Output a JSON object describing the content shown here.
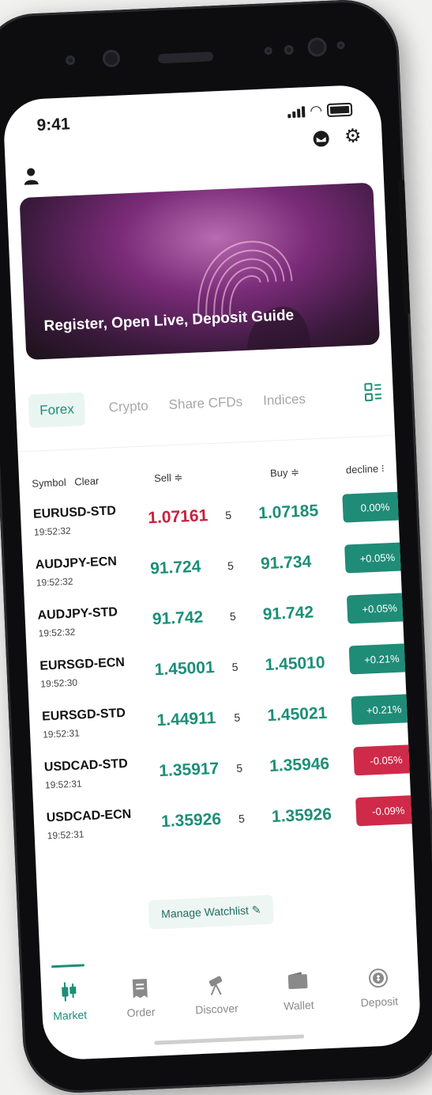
{
  "status": {
    "time": "9:41"
  },
  "header": {
    "profile_icon": "user-icon",
    "mail_icon": "mail-icon",
    "settings_icon": "gear-icon"
  },
  "banner": {
    "title": "Register, Open Live, Deposit Guide"
  },
  "tabs": [
    {
      "label": "Forex",
      "active": true
    },
    {
      "label": "Crypto"
    },
    {
      "label": "Share CFDs"
    },
    {
      "label": "Indices"
    }
  ],
  "table": {
    "headers": {
      "symbol": "Symbol",
      "clear": "Clear",
      "sell": "Sell ≑",
      "buy": "Buy ≑",
      "decline": "decline ⁝"
    },
    "rows": [
      {
        "symbol": "EURUSD-STD",
        "time": "19:52:32",
        "sell": "1.07161",
        "spread": "5",
        "buy": "1.07185",
        "change": "0.00%",
        "sell_color": "red",
        "change_color": "green"
      },
      {
        "symbol": "AUDJPY-ECN",
        "time": "19:52:32",
        "sell": "91.724",
        "spread": "5",
        "buy": "91.734",
        "change": "+0.05%",
        "sell_color": "green",
        "change_color": "green"
      },
      {
        "symbol": "AUDJPY-STD",
        "time": "19:52:32",
        "sell": "91.742",
        "spread": "5",
        "buy": "91.742",
        "change": "+0.05%",
        "sell_color": "green",
        "change_color": "green"
      },
      {
        "symbol": "EURSGD-ECN",
        "time": "19:52:30",
        "sell": "1.45001",
        "spread": "5",
        "buy": "1.45010",
        "change": "+0.21%",
        "sell_color": "green",
        "change_color": "green"
      },
      {
        "symbol": "EURSGD-STD",
        "time": "19:52:31",
        "sell": "1.44911",
        "spread": "5",
        "buy": "1.45021",
        "change": "+0.21%",
        "sell_color": "green",
        "change_color": "green"
      },
      {
        "symbol": "USDCAD-STD",
        "time": "19:52:31",
        "sell": "1.35917",
        "spread": "5",
        "buy": "1.35946",
        "change": "-0.05%",
        "sell_color": "green",
        "change_color": "red"
      },
      {
        "symbol": "USDCAD-ECN",
        "time": "19:52:31",
        "sell": "1.35926",
        "spread": "5",
        "buy": "1.35926",
        "change": "-0.09%",
        "sell_color": "green",
        "change_color": "red"
      }
    ]
  },
  "watchlist": {
    "label": "Manage Watchlist"
  },
  "nav": [
    {
      "label": "Market",
      "icon": "candlestick-icon",
      "active": true
    },
    {
      "label": "Order",
      "icon": "receipt-icon"
    },
    {
      "label": "Discover",
      "icon": "telescope-icon"
    },
    {
      "label": "Wallet",
      "icon": "wallet-icon"
    },
    {
      "label": "Deposit",
      "icon": "deposit-icon"
    }
  ],
  "colors": {
    "accent": "#1c8f78",
    "up": "#1f8c78",
    "down": "#cf2a49",
    "sell_down": "#c8203e"
  }
}
